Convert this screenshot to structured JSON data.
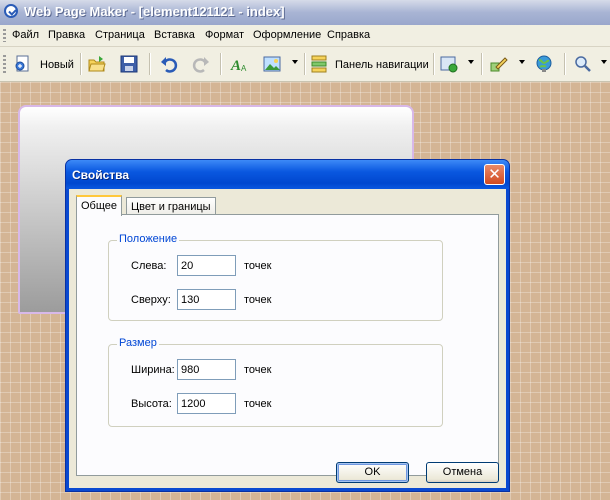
{
  "window": {
    "title": "Web Page Maker - [element121121 - index]"
  },
  "menu": [
    "Файл",
    "Правка",
    "Страница",
    "Вставка",
    "Формат",
    "Оформление",
    "Справка"
  ],
  "toolbar": {
    "new_label": "Новый",
    "nav_panel_label": "Панель навигации",
    "icons": [
      "new-page-icon",
      "open-folder-icon",
      "save-icon",
      "undo-icon",
      "redo-icon",
      "text-style-icon",
      "image-icon",
      "navigation-panel-icon",
      "shape-icon",
      "pencil-icon",
      "globe-icon",
      "zoom-icon"
    ]
  },
  "dialog": {
    "title": "Свойства",
    "tabs": [
      "Общее",
      "Цвет и границы"
    ],
    "position_group": {
      "title": "Положение",
      "left_label": "Слева:",
      "left_value": "20",
      "top_label": "Сверху:",
      "top_value": "130",
      "unit": "точек"
    },
    "size_group": {
      "title": "Размер",
      "width_label": "Ширина:",
      "width_value": "980",
      "height_label": "Высота:",
      "height_value": "1200",
      "unit": "точек"
    },
    "ok_label": "OK",
    "cancel_label": "Отмена"
  }
}
